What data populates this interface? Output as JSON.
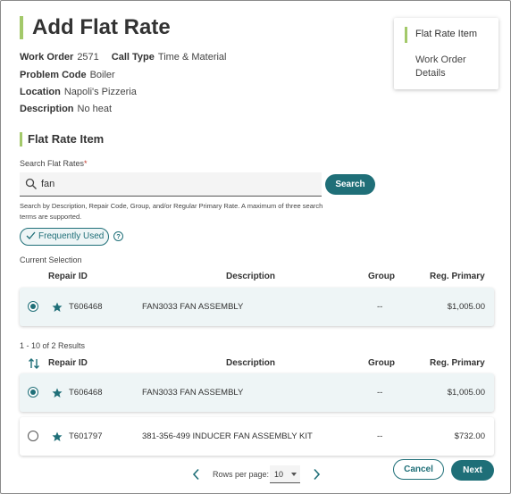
{
  "page": {
    "title": "Add Flat Rate"
  },
  "details": {
    "work_order_label": "Work Order",
    "work_order_value": "2571",
    "call_type_label": "Call Type",
    "call_type_value": "Time & Material",
    "problem_code_label": "Problem Code",
    "problem_code_value": "Boiler",
    "location_label": "Location",
    "location_value": "Napoli's Pizzeria",
    "description_label": "Description",
    "description_value": "No heat"
  },
  "side_nav": {
    "items": [
      {
        "label": "Flat Rate Item",
        "active": true
      },
      {
        "label": "Work Order Details",
        "active": false
      }
    ]
  },
  "section": {
    "title": "Flat Rate Item"
  },
  "search": {
    "label": "Search Flat Rates",
    "required_mark": "*",
    "value": "fan",
    "button_label": "Search",
    "hint": "Search by Description, Repair Code, Group, and/or Regular Primary Rate. A maximum of three search terms are supported."
  },
  "filter": {
    "chip_label": "Frequently Used",
    "help_glyph": "?"
  },
  "current_selection": {
    "label": "Current Selection",
    "headers": {
      "repair_id": "Repair ID",
      "description": "Description",
      "group": "Group",
      "reg_primary": "Reg. Primary"
    },
    "row": {
      "repair_id": "T606468",
      "description": "FAN3033 FAN ASSEMBLY",
      "group": "--",
      "reg_primary": "$1,005.00",
      "selected": true
    }
  },
  "results": {
    "summary": "1 - 10 of 2 Results",
    "headers": {
      "repair_id": "Repair ID",
      "description": "Description",
      "group": "Group",
      "reg_primary": "Reg. Primary"
    },
    "rows": [
      {
        "repair_id": "T606468",
        "description": "FAN3033 FAN ASSEMBLY",
        "group": "--",
        "reg_primary": "$1,005.00",
        "selected": true
      },
      {
        "repair_id": "T601797",
        "description": "381-356-499 INDUCER FAN ASSEMBLY KIT",
        "group": "--",
        "reg_primary": "$732.00",
        "selected": false
      }
    ]
  },
  "pager": {
    "rows_per_page_label": "Rows per page:",
    "rows_per_page_value": "10"
  },
  "footer": {
    "cancel_label": "Cancel",
    "next_label": "Next"
  },
  "colors": {
    "accent_green": "#a3c96a",
    "primary_teal": "#1f6f78",
    "selected_row": "#eef5f6"
  },
  "icons": {
    "search": "search-icon",
    "star": "star-icon",
    "check": "check-icon",
    "help": "help-icon",
    "sort": "sort-icon",
    "prev": "chevron-left-icon",
    "next": "chevron-right-icon",
    "dropdown": "caret-down-icon"
  }
}
